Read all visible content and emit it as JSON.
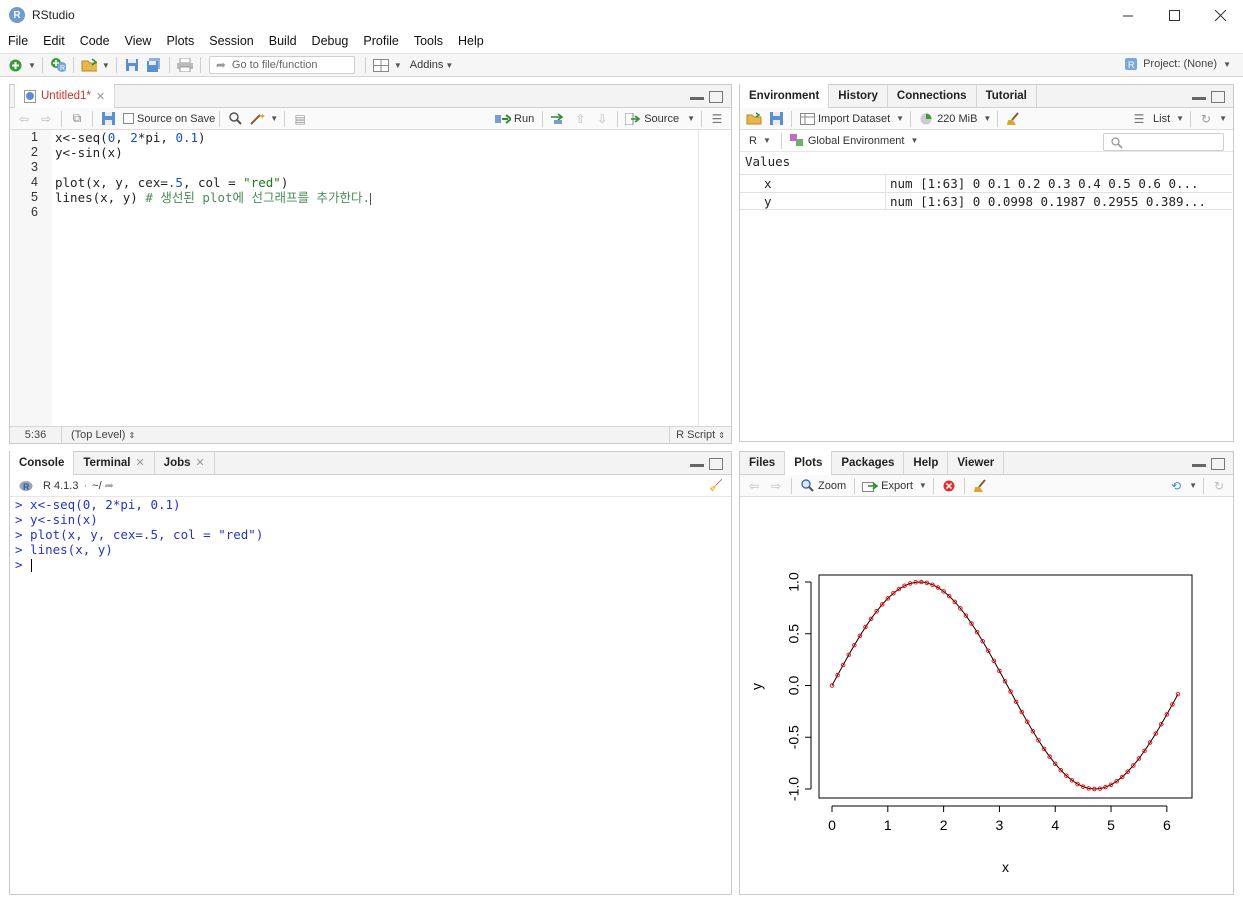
{
  "window": {
    "title": "RStudio",
    "app_icon": "R"
  },
  "menu": [
    "File",
    "Edit",
    "Code",
    "View",
    "Plots",
    "Session",
    "Build",
    "Debug",
    "Profile",
    "Tools",
    "Help"
  ],
  "toolbar": {
    "goto_placeholder": "Go to file/function",
    "addins": "Addins",
    "project": "Project: (None)"
  },
  "editor": {
    "tab": "Untitled1*",
    "source_on_save": "Source on Save",
    "run": "Run",
    "source": "Source",
    "line_numbers": [
      "1",
      "2",
      "3",
      "4",
      "5",
      "6"
    ],
    "lines": [
      "x<-seq(0, 2*pi, 0.1)",
      "y<-sin(x)",
      "",
      "plot(x, y, cex=.5, col = \"red\")",
      "lines(x, y) # 생선된 plot에 선그래프를 추가한다.",
      ""
    ],
    "code": {
      "l1a": "x<-seq(",
      "l1b": "0",
      "l1c": ", ",
      "l1d": "2",
      "l1e": "*pi, ",
      "l1f": "0.1",
      "l1g": ")",
      "l2": "y<-sin(x)",
      "l4a": "plot(x, y, cex=",
      "l4b": ".5",
      "l4c": ", col = ",
      "l4d": "\"red\"",
      "l4e": ")",
      "l5a": "lines(x, y) ",
      "l5b": "# 생선된 plot에 선그래프를 추가한다."
    },
    "status": {
      "position": "5:36",
      "scope": "(Top Level)",
      "type": "R Script"
    }
  },
  "console": {
    "tabs": [
      "Console",
      "Terminal",
      "Jobs"
    ],
    "version": "R 4.1.3",
    "wd": "~/",
    "lines": [
      "> x<-seq(0, 2*pi, 0.1)",
      "> y<-sin(x)",
      "> plot(x, y, cex=.5, col = \"red\")",
      "> lines(x, y)"
    ],
    "prompt": "> "
  },
  "environment": {
    "tabs": [
      "Environment",
      "History",
      "Connections",
      "Tutorial"
    ],
    "import_dataset": "Import Dataset",
    "memory": "220 MiB",
    "view_mode": "List",
    "language": "R",
    "scope": "Global Environment",
    "section": "Values",
    "rows": [
      {
        "name": "x",
        "value": "num [1:63] 0 0.1 0.2 0.3 0.4 0.5 0.6 0..."
      },
      {
        "name": "y",
        "value": "num [1:63] 0 0.0998 0.1987 0.2955 0.389..."
      }
    ]
  },
  "plots": {
    "tabs": [
      "Files",
      "Plots",
      "Packages",
      "Help",
      "Viewer"
    ],
    "zoom": "Zoom",
    "export": "Export"
  },
  "chart_data": {
    "type": "scatter",
    "series": [
      {
        "x_from": 0,
        "x_to": 6.2,
        "x_step": 0.1,
        "function": "sin",
        "point_color": "#ff0000",
        "line_color": "#000000",
        "point_size": 0.5,
        "with_line": true
      }
    ],
    "xlabel": "x",
    "ylabel": "y",
    "xlim": [
      0,
      6.2
    ],
    "ylim": [
      -1,
      1
    ],
    "xticks": [
      "0",
      "1",
      "2",
      "3",
      "4",
      "5",
      "6"
    ],
    "yticks": [
      "-1.0",
      "-0.5",
      "0.0",
      "0.5",
      "1.0"
    ],
    "grid": false
  }
}
